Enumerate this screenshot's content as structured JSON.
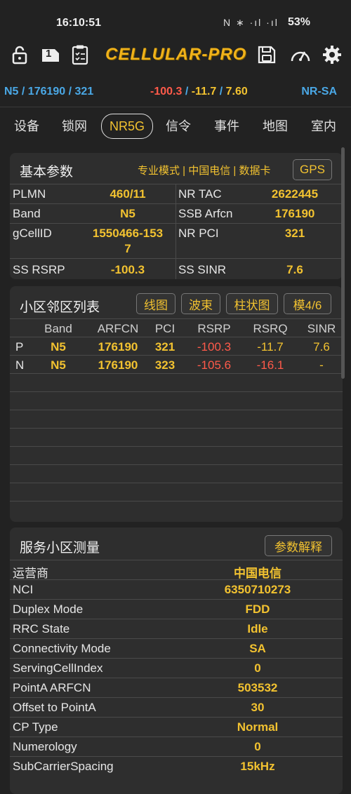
{
  "status": {
    "time": "16:10:51",
    "icons": "N ∗ ·ıl ·ıl",
    "battery": "53%"
  },
  "toolbar": {
    "brand": "CELLULAR-PRO",
    "sim_slot": "1"
  },
  "summary": {
    "left": "N5 / 176190 / 321",
    "rsrp": "-100.3",
    "rsrq": "-11.7",
    "sinr": "7.60",
    "mode": "NR-SA"
  },
  "tabs": [
    "设备",
    "锁网",
    "NR5G",
    "信令",
    "事件",
    "地图",
    "室内"
  ],
  "basic": {
    "title": "基本参数",
    "subtitle": "专业模式 | 中国电信 | 数据卡",
    "gps_button": "GPS",
    "rows": [
      {
        "l1": "PLMN",
        "v1": "460/11",
        "l2": "NR TAC",
        "v2": "2622445"
      },
      {
        "l1": "Band",
        "v1": "N5",
        "l2": "SSB Arfcn",
        "v2": "176190"
      },
      {
        "l1": "gCellID",
        "v1a": "1550466-153",
        "v1b": "7",
        "l2": "NR PCI",
        "v2": "321"
      },
      {
        "l1": "SS RSRP",
        "v1": "-100.3",
        "l2": "SS SINR",
        "v2": "7.6"
      }
    ]
  },
  "neighbors": {
    "title": "小区邻区列表",
    "buttons": [
      "线图",
      "波束",
      "柱状图",
      "模4/6"
    ],
    "headers": [
      "Band",
      "ARFCN",
      "PCI",
      "RSRP",
      "RSRQ",
      "SINR"
    ],
    "rows": [
      {
        "type": "P",
        "band": "N5",
        "arfcn": "176190",
        "pci": "321",
        "rsrp": "-100.3",
        "rsrq": "-11.7",
        "sinr": "7.6"
      },
      {
        "type": "N",
        "band": "N5",
        "arfcn": "176190",
        "pci": "323",
        "rsrp": "-105.6",
        "rsrq": "-16.1",
        "sinr": "-"
      }
    ]
  },
  "serving": {
    "title": "服务小区测量",
    "button": "参数解释",
    "rows": [
      {
        "label": "运营商",
        "value": "中国电信"
      },
      {
        "label": "NCI",
        "value": "6350710273"
      },
      {
        "label": "Duplex Mode",
        "value": "FDD"
      },
      {
        "label": "RRC State",
        "value": "Idle"
      },
      {
        "label": "Connectivity Mode",
        "value": "SA"
      },
      {
        "label": "ServingCellIndex",
        "value": "0"
      },
      {
        "label": "PointA ARFCN",
        "value": "503532"
      },
      {
        "label": "Offset to PointA",
        "value": "30"
      },
      {
        "label": "CP Type",
        "value": "Normal"
      },
      {
        "label": "Numerology",
        "value": "0"
      },
      {
        "label": "SubCarrierSpacing",
        "value": "15kHz"
      }
    ]
  }
}
